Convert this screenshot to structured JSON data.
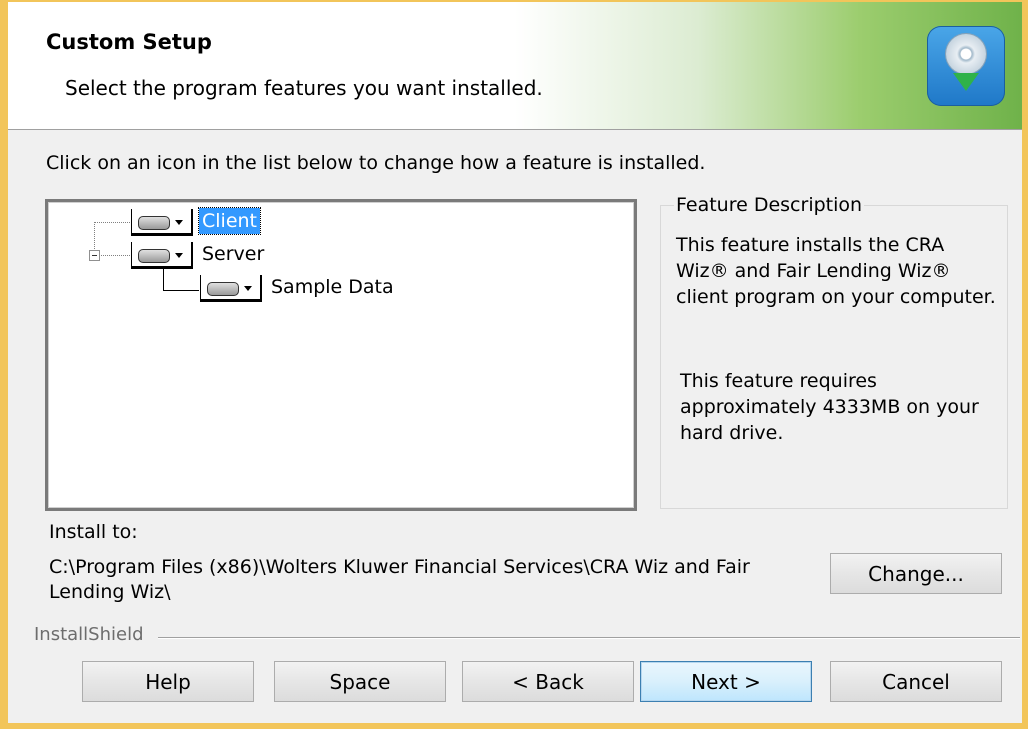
{
  "header": {
    "title": "Custom Setup",
    "subtitle": "Select the program features you want installed.",
    "icon": "install-disc-icon"
  },
  "instruction": "Click on an icon in the list below to change how a feature is installed.",
  "tree": {
    "items": [
      {
        "label": "Client",
        "icon": "hard-drive-icon",
        "selected": true
      },
      {
        "label": "Server",
        "icon": "hard-drive-icon",
        "selected": false
      },
      {
        "label": "Sample Data",
        "icon": "hard-drive-icon",
        "selected": false
      }
    ]
  },
  "description": {
    "legend": "Feature Description",
    "text": "This feature installs the CRA Wiz® and Fair Lending Wiz® client program on your computer.",
    "requirement": "This feature requires approximately 4333MB on your hard drive."
  },
  "install": {
    "label": "Install to:",
    "path": "C:\\Program Files (x86)\\Wolters Kluwer Financial Services\\CRA Wiz and Fair Lending Wiz\\",
    "change_label": "Change..."
  },
  "brand": "InstallShield",
  "buttons": {
    "help": "Help",
    "space": "Space",
    "back": "< Back",
    "next": "Next >",
    "cancel": "Cancel"
  },
  "colors": {
    "window_border": "#f2c55a",
    "selection": "#3399ff",
    "header_gradient_end": "#6fb24a"
  }
}
